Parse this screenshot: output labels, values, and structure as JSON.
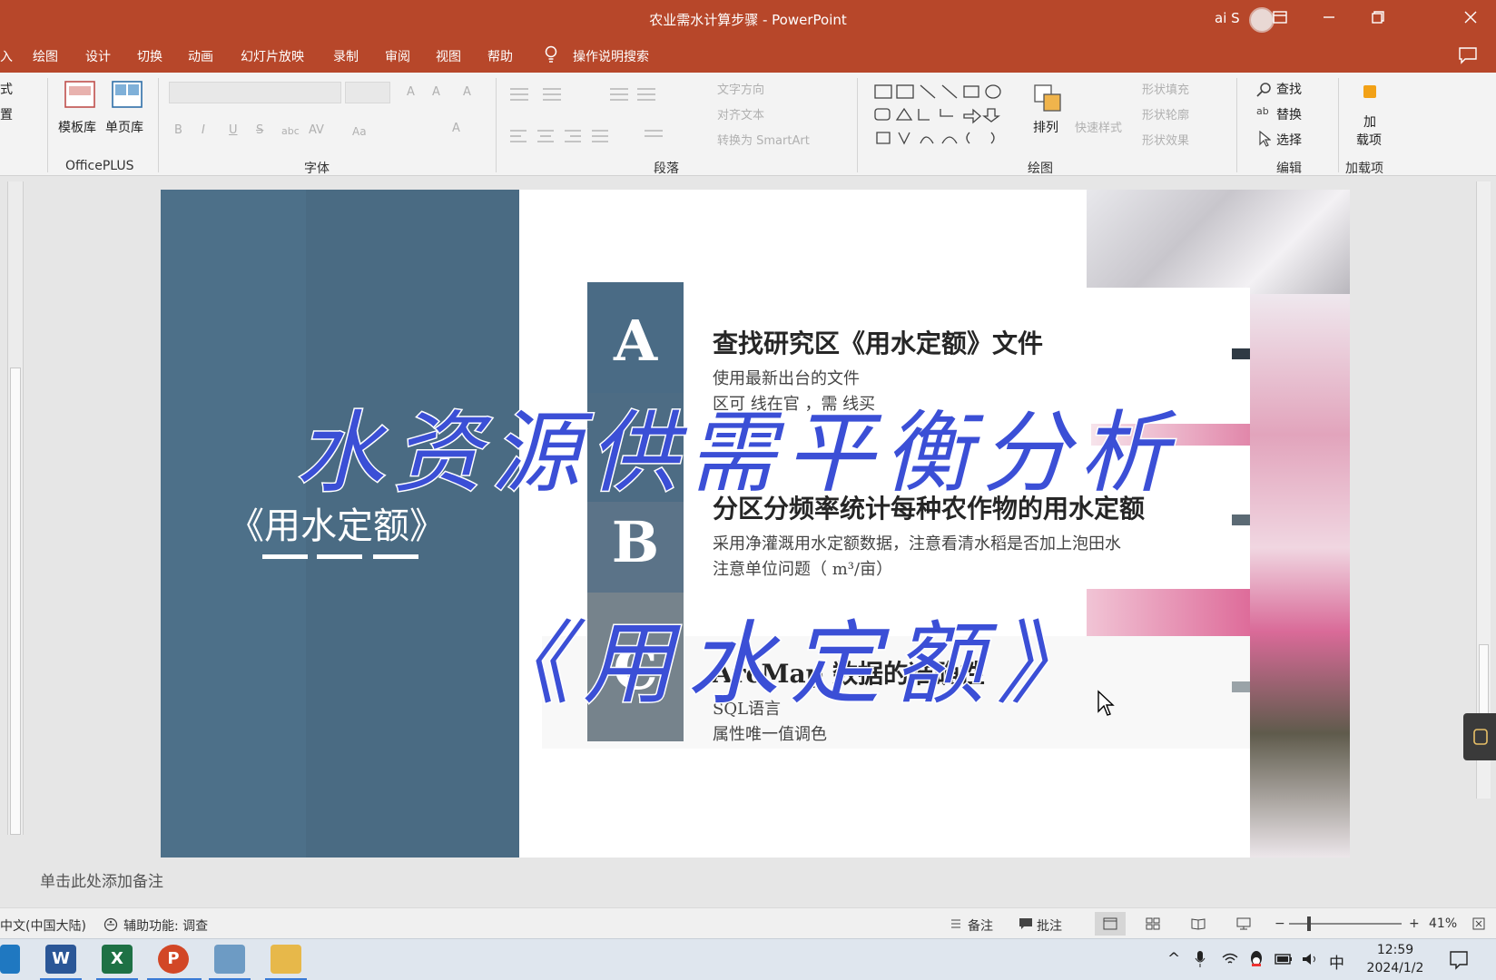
{
  "window": {
    "title": "农业需水计算步骤 - PowerPoint",
    "user": "ai S",
    "controls": [
      "ribbon-display",
      "minimize",
      "restore",
      "close"
    ]
  },
  "menu": {
    "tabs": [
      "入",
      "绘图",
      "设计",
      "切换",
      "动画",
      "幻灯片放映",
      "录制",
      "审阅",
      "视图",
      "帮助"
    ],
    "tell_me": "操作说明搜索"
  },
  "ribbon": {
    "left_partial": [
      "式",
      "置"
    ],
    "officeplus": {
      "template_lib": "模板库",
      "single_page_lib": "单页库",
      "group": "OfficePLUS"
    },
    "font": {
      "group": "字体",
      "buttons": [
        "B",
        "I",
        "U",
        "S",
        "abc",
        "AV",
        "Aa",
        "A"
      ]
    },
    "paragraph": {
      "group": "段落",
      "text_direction": "文字方向",
      "align_text": "对齐文本",
      "smartart": "转换为 SmartArt"
    },
    "drawing": {
      "group": "绘图",
      "arrange": "排列",
      "quick_styles": "快速样式",
      "shape_fill": "形状填充",
      "shape_outline": "形状轮廓",
      "shape_effects": "形状效果"
    },
    "editing": {
      "group": "编辑",
      "find": "查找",
      "replace": "替换",
      "select": "选择"
    },
    "addins": {
      "label_line1": "加",
      "label_line2": "载项",
      "group": "加载项"
    }
  },
  "slide": {
    "left_title": "《用水定额》",
    "items": [
      {
        "letter": "A",
        "title": "查找研究区《用水定额》文件",
        "lines": [
          "使用最新出台的文件",
          "区可   线在官     ，需     线买"
        ]
      },
      {
        "letter": "B",
        "title": "分区分频率统计每种农作物的用水定额",
        "lines": [
          "采用净灌溉用水定额数据，注意看清水稻是否加上泡田水",
          "注意单位问题（ m³/亩）"
        ]
      },
      {
        "letter": "C",
        "title": "ArcMap     数据的准确性",
        "lines": [
          "SQL语言",
          "属性唯一值调色"
        ]
      }
    ],
    "overlay_line1": "水资源供需平衡分析",
    "overlay_line2": "《用水定额》",
    "colors": {
      "panel": "#4d7089",
      "letter_a": "#4a6b85",
      "letter_b": "#5b7388",
      "letter_c": "#76838c",
      "overlay": "#3b4fd6"
    }
  },
  "notes": {
    "placeholder": "单击此处添加备注"
  },
  "status": {
    "language": "中文(中国大陆)",
    "accessibility": "辅助功能: 调查",
    "notes_btn": "备注",
    "comments_btn": "批注",
    "zoom": "41%"
  },
  "taskbar": {
    "apps": [
      "outlook",
      "word",
      "excel",
      "powerpoint",
      "editor",
      "explorer"
    ],
    "ime": "中",
    "time": "12:59",
    "date": "2024/1/2"
  }
}
